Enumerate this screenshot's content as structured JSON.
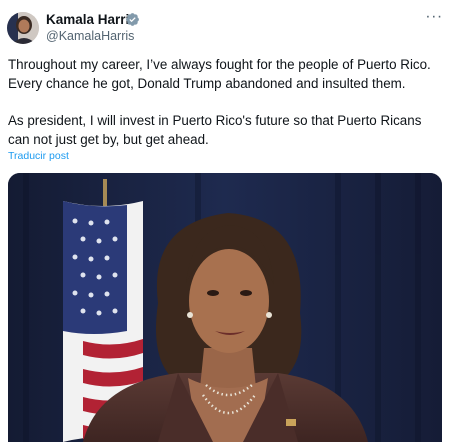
{
  "tweet": {
    "author": {
      "display_name": "Kamala Harris",
      "handle": "@KamalaHarris",
      "verified": true,
      "verified_icon": "verified-badge-icon"
    },
    "more_icon": "more-options-icon",
    "more_label": "···",
    "text_lines": [
      "Throughout my career, I’ve always fought for the people of Puerto Rico.",
      "Every chance he got, Donald Trump abandoned and insulted them.",
      "As president, I will invest in Puerto Rico's future so that Puerto Ricans",
      "can not just get by, but get ahead."
    ],
    "translate_label": "Traducir post",
    "media": {
      "type": "video-still",
      "description_icon": "speaker-video-frame"
    }
  },
  "colors": {
    "text": "#0f1419",
    "secondary": "#536471",
    "link": "#1d9bf0",
    "verified": "#829aab",
    "media_background": "#16213f"
  }
}
